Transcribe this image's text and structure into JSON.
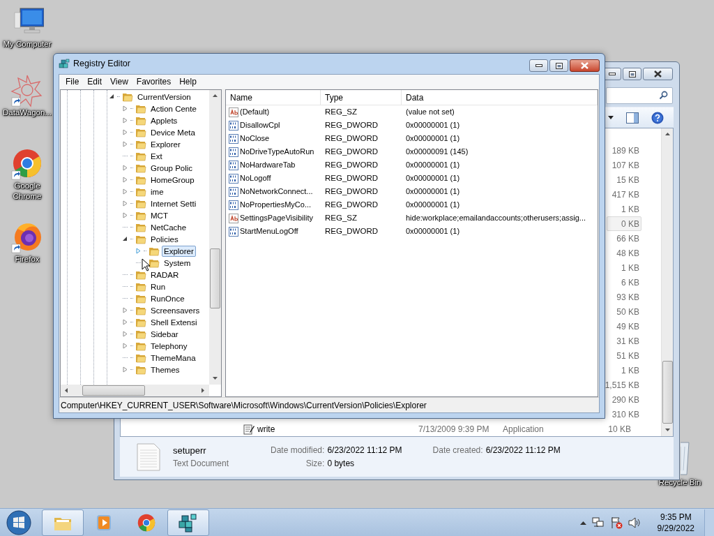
{
  "desktop_icons": [
    {
      "label": "My Computer",
      "kind": "computer",
      "shortcut": false
    },
    {
      "label": "DataWagon...",
      "kind": "datawagon",
      "shortcut": true
    },
    {
      "label": "Google Chrome",
      "kind": "chrome",
      "shortcut": true
    },
    {
      "label": "Firefox",
      "kind": "firefox",
      "shortcut": true
    }
  ],
  "recycle_bin": {
    "label": "Recycle Bin"
  },
  "explorer": {
    "size_rows": [
      {
        "size": "189 KB",
        "selected": false
      },
      {
        "size": "107 KB",
        "selected": false
      },
      {
        "size": "15 KB",
        "selected": false
      },
      {
        "size": "417 KB",
        "selected": false
      },
      {
        "size": "1 KB",
        "selected": false
      },
      {
        "size": "0 KB",
        "selected": true
      },
      {
        "size": "66 KB",
        "selected": false
      },
      {
        "size": "48 KB",
        "selected": false
      },
      {
        "size": "1 KB",
        "selected": false
      },
      {
        "size": "6 KB",
        "selected": false
      },
      {
        "size": "93 KB",
        "selected": false
      },
      {
        "size": "50 KB",
        "selected": false
      },
      {
        "size": "49 KB",
        "selected": false
      },
      {
        "size": "31 KB",
        "selected": false
      },
      {
        "size": "51 KB",
        "selected": false
      },
      {
        "size": "1 KB",
        "selected": false
      },
      {
        "size": "1,515 KB",
        "selected": false
      },
      {
        "size": "290 KB",
        "selected": false
      },
      {
        "size": "310 KB",
        "selected": false
      }
    ],
    "last_row": {
      "name": "write",
      "date": "7/13/2009 9:39 PM",
      "type": "Application",
      "size": "10 KB"
    },
    "details": {
      "name": "setuperr",
      "type": "Text Document",
      "fields": [
        {
          "label": "Date modified:",
          "value": "6/23/2022 11:12 PM"
        },
        {
          "label": "Date created:",
          "value": "6/23/2022 11:12 PM"
        },
        {
          "label": "Size:",
          "value": "0 bytes"
        }
      ]
    }
  },
  "registry": {
    "title": "Registry Editor",
    "menu": [
      "File",
      "Edit",
      "View",
      "Favorites",
      "Help"
    ],
    "tree": {
      "label": "CurrentVersion",
      "expandable": true,
      "expanded": true,
      "selected": false,
      "children": [
        {
          "label": "Action Cente",
          "expandable": true,
          "expanded": false,
          "selected": false
        },
        {
          "label": "Applets",
          "expandable": true,
          "expanded": false,
          "selected": false
        },
        {
          "label": "Device Meta",
          "expandable": true,
          "expanded": false,
          "selected": false
        },
        {
          "label": "Explorer",
          "expandable": true,
          "expanded": false,
          "selected": false
        },
        {
          "label": "Ext",
          "expandable": false,
          "selected": false
        },
        {
          "label": "Group Polic",
          "expandable": true,
          "expanded": false,
          "selected": false
        },
        {
          "label": "HomeGroup",
          "expandable": true,
          "expanded": false,
          "selected": false
        },
        {
          "label": "ime",
          "expandable": true,
          "expanded": false,
          "selected": false
        },
        {
          "label": "Internet Setti",
          "expandable": true,
          "expanded": false,
          "selected": false
        },
        {
          "label": "MCT",
          "expandable": true,
          "expanded": false,
          "selected": false
        },
        {
          "label": "NetCache",
          "expandable": false,
          "selected": false
        },
        {
          "label": "Policies",
          "expandable": true,
          "expanded": true,
          "selected": false,
          "children": [
            {
              "label": "Explorer",
              "expandable": true,
              "expanded": false,
              "selected": true
            },
            {
              "label": "System",
              "expandable": false,
              "selected": false
            }
          ]
        },
        {
          "label": "RADAR",
          "expandable": false,
          "selected": false
        },
        {
          "label": "Run",
          "expandable": false,
          "selected": false
        },
        {
          "label": "RunOnce",
          "expandable": false,
          "selected": false
        },
        {
          "label": "Screensavers",
          "expandable": true,
          "expanded": false,
          "selected": false
        },
        {
          "label": "Shell Extensi",
          "expandable": true,
          "expanded": false,
          "selected": false
        },
        {
          "label": "Sidebar",
          "expandable": true,
          "expanded": false,
          "selected": false
        },
        {
          "label": "Telephony",
          "expandable": true,
          "expanded": false,
          "selected": false
        },
        {
          "label": "ThemeMana",
          "expandable": false,
          "selected": false
        },
        {
          "label": "Themes",
          "expandable": true,
          "expanded": false,
          "selected": false
        }
      ]
    },
    "columns": [
      "Name",
      "Type",
      "Data"
    ],
    "values": [
      {
        "name": "(Default)",
        "type": "REG_SZ",
        "data": "(value not set)",
        "kind": "string"
      },
      {
        "name": "DisallowCpl",
        "type": "REG_DWORD",
        "data": "0x00000001 (1)",
        "kind": "number"
      },
      {
        "name": "NoClose",
        "type": "REG_DWORD",
        "data": "0x00000001 (1)",
        "kind": "number"
      },
      {
        "name": "NoDriveTypeAutoRun",
        "type": "REG_DWORD",
        "data": "0x00000091 (145)",
        "kind": "number"
      },
      {
        "name": "NoHardwareTab",
        "type": "REG_DWORD",
        "data": "0x00000001 (1)",
        "kind": "number"
      },
      {
        "name": "NoLogoff",
        "type": "REG_DWORD",
        "data": "0x00000001 (1)",
        "kind": "number"
      },
      {
        "name": "NoNetworkConnect...",
        "type": "REG_DWORD",
        "data": "0x00000001 (1)",
        "kind": "number"
      },
      {
        "name": "NoPropertiesMyCo...",
        "type": "REG_DWORD",
        "data": "0x00000001 (1)",
        "kind": "number"
      },
      {
        "name": "SettingsPageVisibility",
        "type": "REG_SZ",
        "data": "hide:workplace;emailandaccounts;otherusers;assig...",
        "kind": "string"
      },
      {
        "name": "StartMenuLogOff",
        "type": "REG_DWORD",
        "data": "0x00000001 (1)",
        "kind": "number"
      }
    ],
    "status": "Computer\\HKEY_CURRENT_USER\\Software\\Microsoft\\Windows\\CurrentVersion\\Policies\\Explorer"
  },
  "taskbar": {
    "apps": [
      {
        "kind": "explorer",
        "active": true
      },
      {
        "kind": "media",
        "active": false
      },
      {
        "kind": "chrome",
        "active": false
      },
      {
        "kind": "regedit",
        "active": true
      }
    ],
    "time": "9:35 PM",
    "date": "9/29/2022"
  }
}
